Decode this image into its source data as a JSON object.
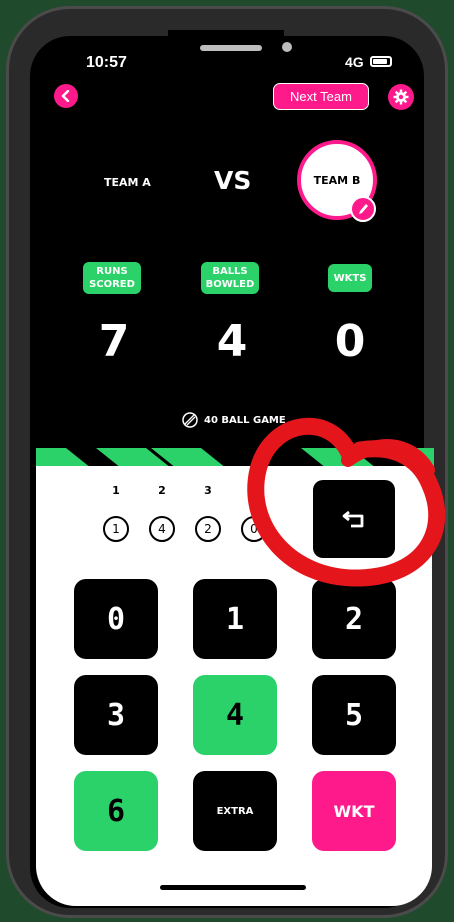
{
  "status": {
    "time": "10:57",
    "network": "4G"
  },
  "header": {
    "next_team_label": "Next Team"
  },
  "teams": {
    "team_a": "TEAM A",
    "vs": "VS",
    "team_b": "TEAM B"
  },
  "stats": [
    {
      "label_line1": "RUNS",
      "label_line2": "SCORED",
      "value": "7"
    },
    {
      "label_line1": "BALLS",
      "label_line2": "BOWLED",
      "value": "4"
    },
    {
      "label_line1": "WKTS",
      "label_line2": "",
      "value": "0"
    }
  ],
  "game_type": "40 BALL GAME",
  "balls": {
    "numbers": [
      "1",
      "2",
      "3"
    ],
    "results": [
      "1",
      "4",
      "2",
      "0"
    ]
  },
  "keypad": [
    "0",
    "1",
    "2",
    "3",
    "4",
    "5",
    "6",
    "EXTRA",
    "WKT"
  ],
  "colors": {
    "accent_pink": "#ff1a8c",
    "accent_green": "#2bd26a",
    "annotation_red": "#e4161c"
  }
}
